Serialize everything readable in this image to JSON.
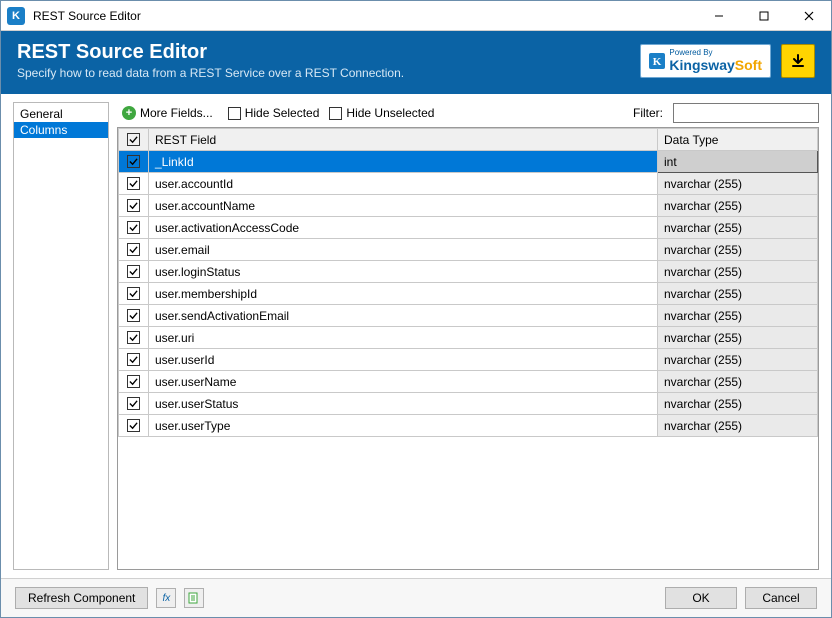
{
  "window": {
    "title": "REST Source Editor"
  },
  "banner": {
    "title": "REST Source Editor",
    "subtitle": "Specify how to read data from a REST Service over a REST Connection.",
    "powered_by": "Powered By",
    "brand1": "Kingsway",
    "brand2": "Soft"
  },
  "sidebar": {
    "items": [
      {
        "label": "General",
        "selected": false
      },
      {
        "label": "Columns",
        "selected": true
      }
    ]
  },
  "toolbar": {
    "more_fields": "More Fields...",
    "hide_selected": "Hide Selected",
    "hide_unselected": "Hide Unselected",
    "filter_label": "Filter:",
    "filter_value": ""
  },
  "grid": {
    "headers": {
      "field": "REST Field",
      "type": "Data Type"
    },
    "rows": [
      {
        "checked": true,
        "selected": true,
        "field": "_LinkId",
        "type": "int"
      },
      {
        "checked": true,
        "selected": false,
        "field": "user.accountId",
        "type": "nvarchar (255)"
      },
      {
        "checked": true,
        "selected": false,
        "field": "user.accountName",
        "type": "nvarchar (255)"
      },
      {
        "checked": true,
        "selected": false,
        "field": "user.activationAccessCode",
        "type": "nvarchar (255)"
      },
      {
        "checked": true,
        "selected": false,
        "field": "user.email",
        "type": "nvarchar (255)"
      },
      {
        "checked": true,
        "selected": false,
        "field": "user.loginStatus",
        "type": "nvarchar (255)"
      },
      {
        "checked": true,
        "selected": false,
        "field": "user.membershipId",
        "type": "nvarchar (255)"
      },
      {
        "checked": true,
        "selected": false,
        "field": "user.sendActivationEmail",
        "type": "nvarchar (255)"
      },
      {
        "checked": true,
        "selected": false,
        "field": "user.uri",
        "type": "nvarchar (255)"
      },
      {
        "checked": true,
        "selected": false,
        "field": "user.userId",
        "type": "nvarchar (255)"
      },
      {
        "checked": true,
        "selected": false,
        "field": "user.userName",
        "type": "nvarchar (255)"
      },
      {
        "checked": true,
        "selected": false,
        "field": "user.userStatus",
        "type": "nvarchar (255)"
      },
      {
        "checked": true,
        "selected": false,
        "field": "user.userType",
        "type": "nvarchar (255)"
      }
    ]
  },
  "footer": {
    "refresh": "Refresh Component",
    "ok": "OK",
    "cancel": "Cancel",
    "fx_tip": "fx",
    "doc_tip": "doc"
  }
}
